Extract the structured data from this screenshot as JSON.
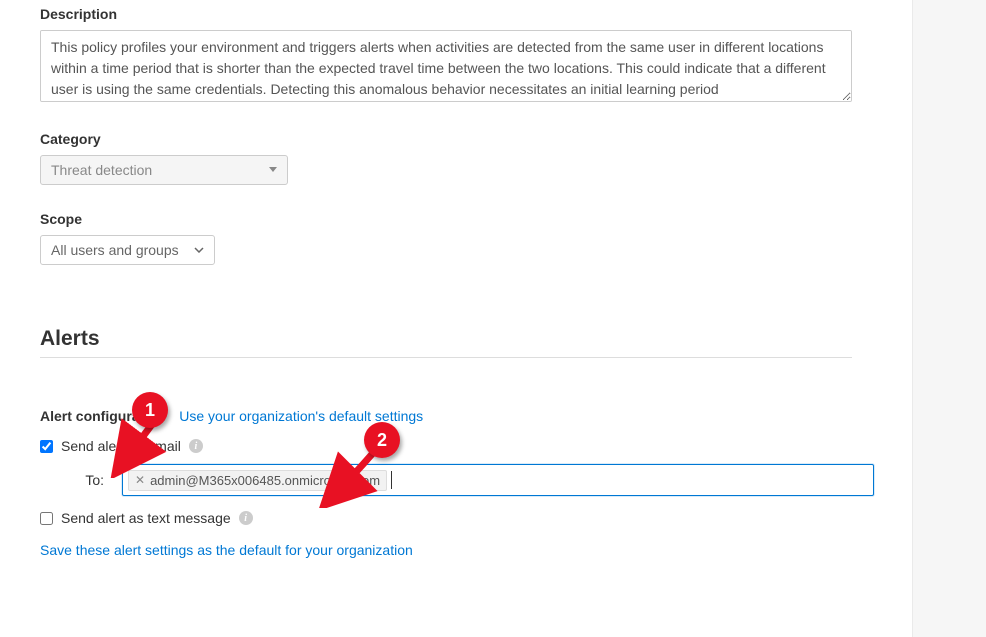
{
  "description": {
    "label": "Description",
    "text": "This policy profiles your environment and triggers alerts when activities are detected from the same user in different locations within a time period that is shorter than the expected travel time between the two locations. This could indicate that a different user is using the same credentials. Detecting this anomalous behavior necessitates an initial learning period"
  },
  "category": {
    "label": "Category",
    "selected": "Threat detection"
  },
  "scope": {
    "label": "Scope",
    "selected": "All users and groups"
  },
  "alerts": {
    "heading": "Alerts",
    "config_label": "Alert configuration",
    "use_default_link": "Use your organization's default settings",
    "send_email_label": "Send alert as email",
    "send_email_checked": true,
    "to_label": "To:",
    "email_chip": "admin@M365x006485.onmicrosoft.com",
    "send_sms_label": "Send alert as text message",
    "send_sms_checked": false,
    "save_defaults_link": "Save these alert settings as the default for your organization"
  },
  "annotations": {
    "badge1": "1",
    "badge2": "2"
  }
}
